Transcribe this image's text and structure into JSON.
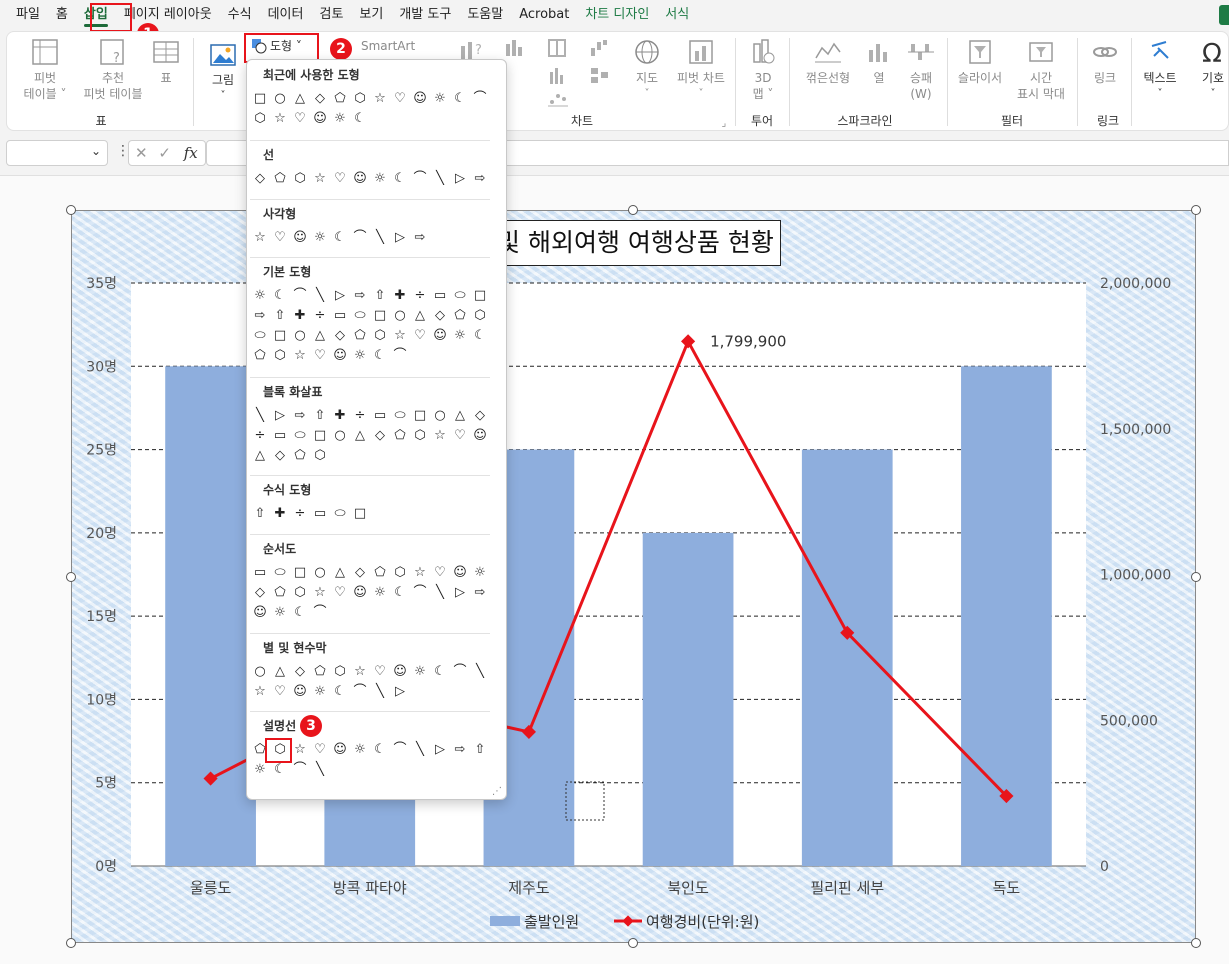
{
  "menu": {
    "items": [
      "파일",
      "홈",
      "삽입",
      "페이지 레이아웃",
      "수식",
      "데이터",
      "검토",
      "보기",
      "개발 도구",
      "도움말",
      "Acrobat",
      "차트 디자인",
      "서식"
    ],
    "active": "삽입"
  },
  "annotations": [
    "1",
    "2",
    "3"
  ],
  "ribbon": {
    "pivot_label1": "피벗",
    "pivot_label2": "테이블 ˅",
    "rec_pivot_label1": "추천",
    "rec_pivot_label2": "피벗 테이블",
    "table_label": "표",
    "group_table": "표",
    "picture_label": "그림",
    "shapes_label": "도형 ˅",
    "smartart_label": "SmartArt",
    "map_label": "지도",
    "pivotchart_label": "피벗 차트",
    "map3d_label1": "3D",
    "map3d_label2": "맵 ˅",
    "group_chart": "차트",
    "group_tour": "투어",
    "line_label": "꺾은선형",
    "column_label": "열",
    "winloss_label1": "승패",
    "winloss_label2": "(W)",
    "group_sparkline": "스파크라인",
    "slicer_label": "슬라이서",
    "timeline_label1": "시간",
    "timeline_label2": "표시 막대",
    "group_filter": "필터",
    "link_label": "링크",
    "group_link": "링크",
    "text_label": "텍스트",
    "symbol_label": "기호"
  },
  "formula_bar": {
    "fx_label": "fx"
  },
  "dropdown": {
    "sections": [
      "최근에 사용한 도형",
      "선",
      "사각형",
      "기본 도형",
      "블록 화살표",
      "수식 도형",
      "순서도",
      "별 및 현수막",
      "설명선"
    ]
  },
  "chart_data": {
    "type": "bar",
    "title": "및 해외여행 여행상품 현황",
    "categories": [
      "울릉도",
      "방콕 파타야",
      "제주도",
      "북인도",
      "필리핀 세부",
      "독도"
    ],
    "series": [
      {
        "name": "출발인원",
        "type": "bar",
        "axis": "left",
        "color": "#8eaedd",
        "values": [
          30,
          25,
          25,
          20,
          25,
          30
        ]
      },
      {
        "name": "여행경비(단위:원)",
        "type": "line",
        "axis": "right",
        "color": "#e8141b",
        "values": [
          300000,
          580000,
          460000,
          1799900,
          800000,
          240000
        ]
      }
    ],
    "y_left": {
      "ylim": [
        0,
        35
      ],
      "ticks": [
        "0명",
        "5명",
        "10명",
        "15명",
        "20명",
        "25명",
        "30명",
        "35명"
      ]
    },
    "y_right": {
      "ylim": [
        0,
        2000000
      ],
      "ticks": [
        "0",
        "500,000",
        "1,000,000",
        "1,500,000",
        "2,000,000"
      ]
    },
    "data_labels": [
      "1,799,900"
    ],
    "grid": true,
    "legend": "bottom"
  }
}
